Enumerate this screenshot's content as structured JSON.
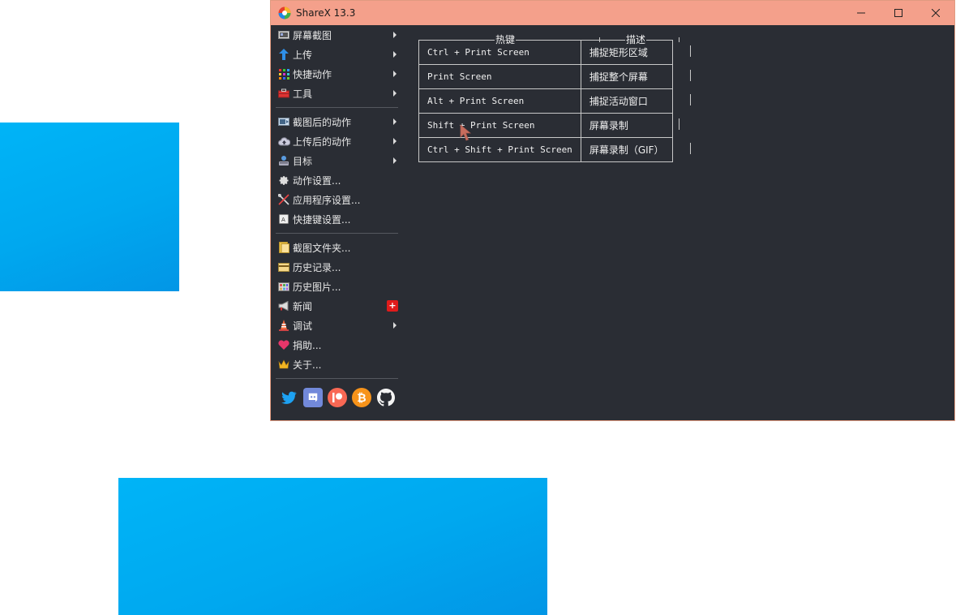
{
  "window": {
    "title": "ShareX 13.3"
  },
  "menu": {
    "group1": [
      {
        "label": "屏幕截图",
        "icon": "screenshot-icon",
        "submenu": true
      },
      {
        "label": "上传",
        "icon": "upload-arrow-icon",
        "submenu": true
      },
      {
        "label": "快捷动作",
        "icon": "quick-actions-grid-icon",
        "submenu": true
      },
      {
        "label": "工具",
        "icon": "toolbox-icon",
        "submenu": true
      }
    ],
    "group2": [
      {
        "label": "截图后的动作",
        "icon": "after-capture-icon",
        "submenu": true
      },
      {
        "label": "上传后的动作",
        "icon": "after-upload-cloud-icon",
        "submenu": true
      },
      {
        "label": "目标",
        "icon": "destinations-icon",
        "submenu": true
      },
      {
        "label": "动作设置...",
        "icon": "gear-icon",
        "submenu": false
      },
      {
        "label": "应用程序设置...",
        "icon": "wrench-screwdriver-icon",
        "submenu": false
      },
      {
        "label": "快捷键设置...",
        "icon": "keyboard-key-icon",
        "submenu": false
      }
    ],
    "group3": [
      {
        "label": "截图文件夹...",
        "icon": "folder-icon",
        "submenu": false
      },
      {
        "label": "历史记录...",
        "icon": "history-card-icon",
        "submenu": false
      },
      {
        "label": "历史图片...",
        "icon": "image-history-icon",
        "submenu": false
      },
      {
        "label": "新闻",
        "icon": "megaphone-icon",
        "submenu": false,
        "badge": "+"
      },
      {
        "label": "调试",
        "icon": "traffic-cone-icon",
        "submenu": true
      },
      {
        "label": "捐助...",
        "icon": "heart-icon",
        "submenu": false
      },
      {
        "label": "关于...",
        "icon": "crown-icon",
        "submenu": false
      }
    ],
    "social": [
      "twitter-icon",
      "discord-icon",
      "patreon-icon",
      "bitcoin-icon",
      "github-icon"
    ]
  },
  "hotkeys": {
    "headers": {
      "hotkey": "热键",
      "description": "描述"
    },
    "rows": [
      {
        "hotkey": "Ctrl + Print Screen",
        "description": "捕捉矩形区域"
      },
      {
        "hotkey": "Print Screen",
        "description": "捕捉整个屏幕"
      },
      {
        "hotkey": "Alt + Print Screen",
        "description": "捕捉活动窗口"
      },
      {
        "hotkey": "Shift + Print Screen",
        "description": "屏幕录制"
      },
      {
        "hotkey": "Ctrl + Shift + Print Screen",
        "description": "屏幕录制（GIF）"
      }
    ]
  },
  "colors": {
    "titlebar": "#f4a08b",
    "panel": "#2a2d34",
    "wallpaper": "#00a8ef"
  }
}
